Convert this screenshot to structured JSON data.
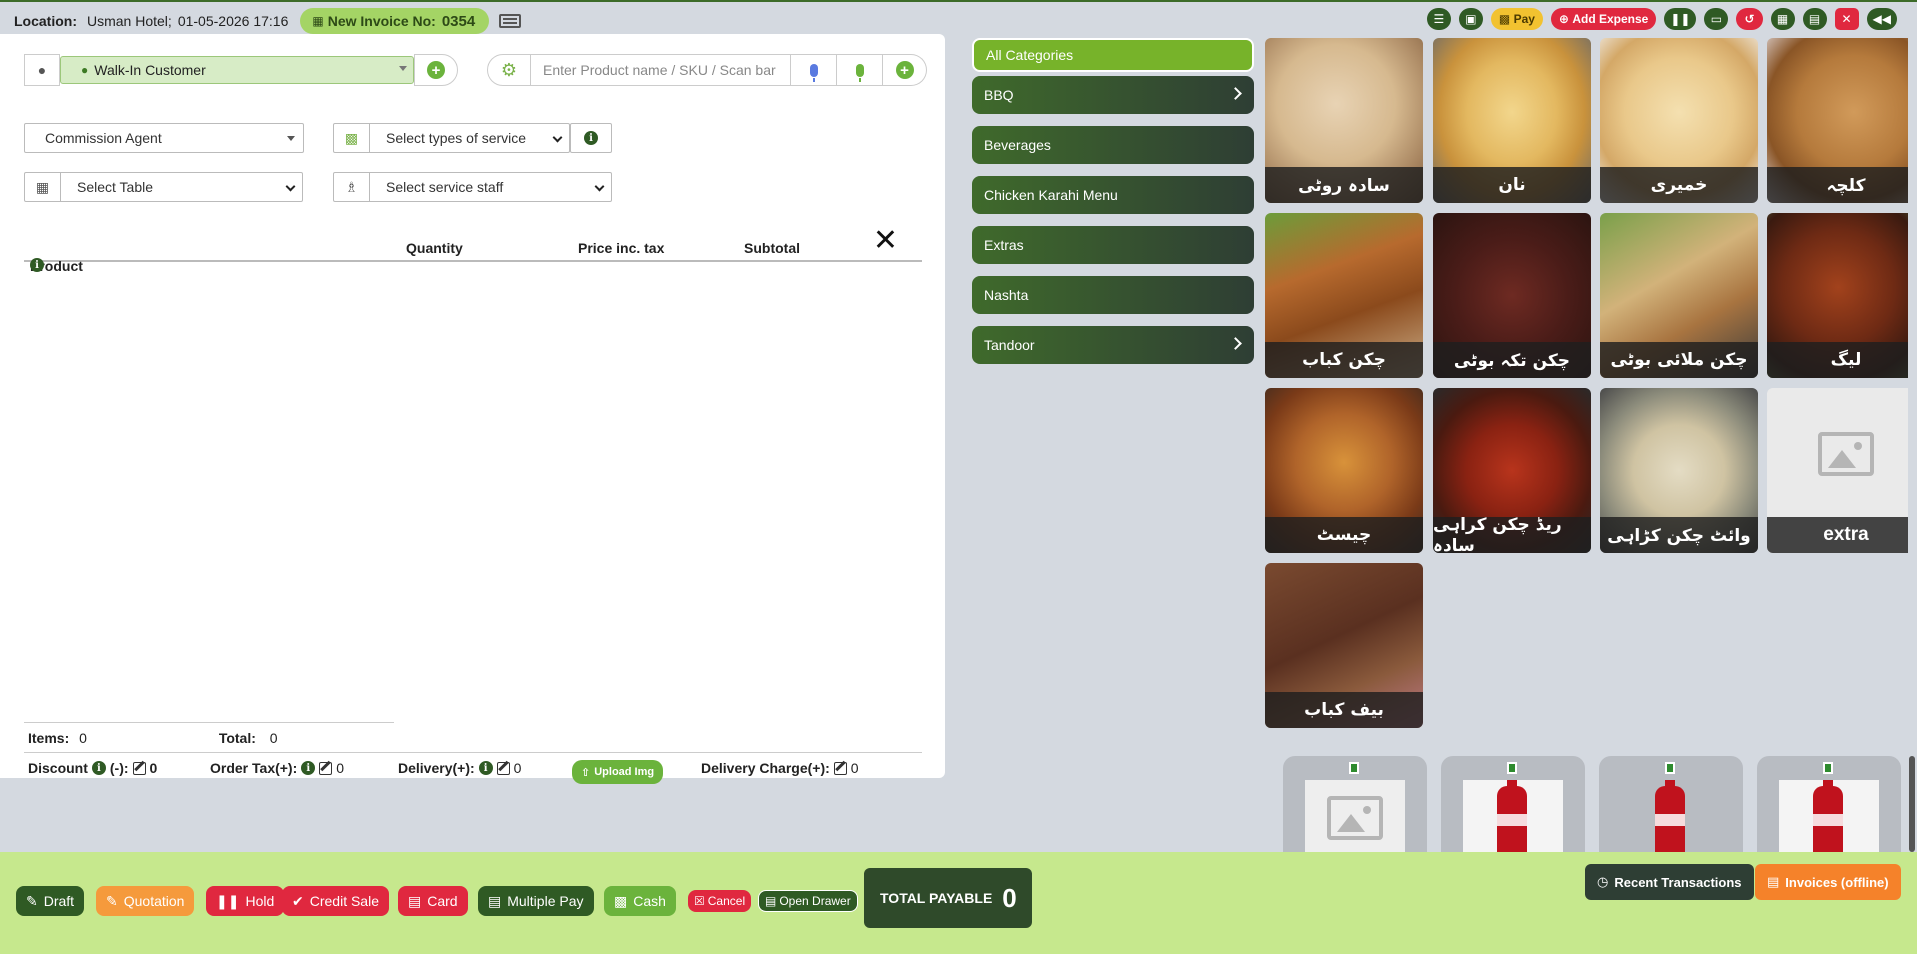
{
  "topbar": {
    "location_label": "Location:",
    "location_value": "Usman Hotel;",
    "datetime": "01-05-2026 17:16",
    "invoice_label": "New Invoice No:",
    "invoice_number": "0354",
    "pay_label": "Pay",
    "add_expense_label": "Add Expense"
  },
  "customer": {
    "selected": "Walk-In Customer"
  },
  "search": {
    "placeholder": "Enter Product name / SKU / Scan bar code"
  },
  "commission": {
    "selected": "Commission Agent"
  },
  "service_type": {
    "placeholder": "Select types of service"
  },
  "table_select": {
    "placeholder": "Select Table"
  },
  "service_staff": {
    "placeholder": "Select service staff"
  },
  "cart": {
    "columns": {
      "product": "Product",
      "quantity": "Quantity",
      "price": "Price inc. tax",
      "subtotal": "Subtotal"
    },
    "items_label": "Items:",
    "items_value": "0",
    "total_label": "Total:",
    "total_value": "0",
    "discount_label": "Discount",
    "discount_sign": "(-):",
    "discount_value": "0",
    "order_tax_label": "Order Tax(+):",
    "order_tax_value": "0",
    "delivery_label": "Delivery(+):",
    "delivery_value": "0",
    "upload_label": "Upload Img",
    "delivery_charge_label": "Delivery Charge(+):",
    "delivery_charge_value": "0"
  },
  "categories": [
    "All Categories",
    "BBQ",
    "Beverages",
    "Chicken Karahi Menu",
    "Extras",
    "Nashta",
    "Tandoor"
  ],
  "products": [
    {
      "name": "سادہ روٹی"
    },
    {
      "name": "نان"
    },
    {
      "name": "خمیری"
    },
    {
      "name": "کلچہ"
    },
    {
      "name": "چکن کباب"
    },
    {
      "name": "چکن تکہ بوٹی"
    },
    {
      "name": "چکن ملائی بوٹی"
    },
    {
      "name": "لیگ"
    },
    {
      "name": "چیسٹ"
    },
    {
      "name": "ریڈ چکن کراہی سادہ"
    },
    {
      "name": "وائٹ چکن کڑاہی"
    },
    {
      "name": "extra"
    },
    {
      "name": "بیف کباب"
    }
  ],
  "footer": {
    "draft": "Draft",
    "quotation": "Quotation",
    "hold": "Hold",
    "credit_sale": "Credit Sale",
    "card": "Card",
    "multiple_pay": "Multiple Pay",
    "cash": "Cash",
    "cancel": "Cancel",
    "open_drawer": "Open Drawer",
    "total_payable_label": "TOTAL PAYABLE",
    "total_payable_value": "0",
    "recent_transactions": "Recent Transactions",
    "invoices_offline": "Invoices (offline)"
  },
  "colors": {
    "primary_green": "#2f5a24",
    "accent_green": "#6bb33c",
    "danger": "#e0283f",
    "footer_bg": "#c6e88d"
  }
}
